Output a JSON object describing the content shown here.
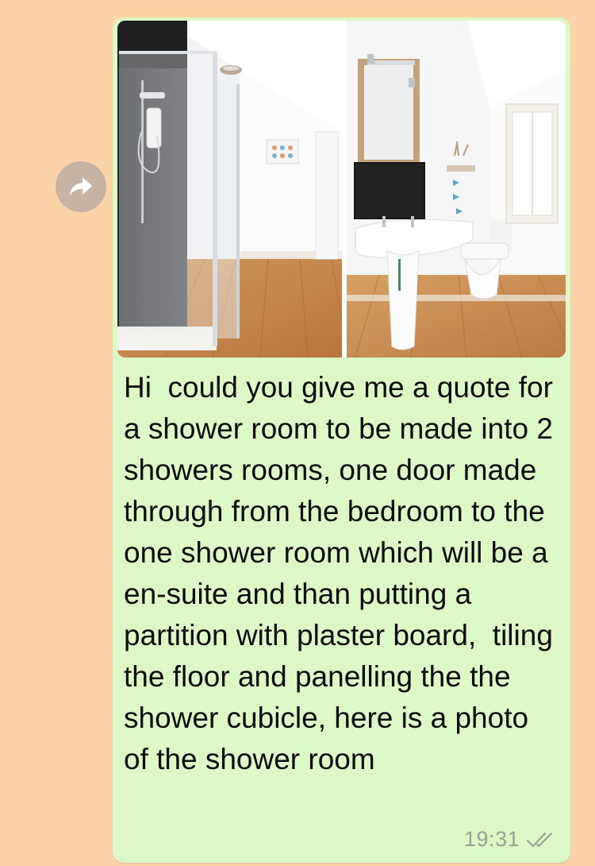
{
  "conversation": {
    "forward_icon": "forward-arrow-icon",
    "message": {
      "photo_alt": "Photo of the shower room: glass shower cubicle on the left, pedestal sink with mirror and toilet on the right, wooden floor",
      "text": "Hi  could you give me a quote for a shower room to be made into 2 showers rooms, one door made through from the bedroom to the one shower room which will be a en-suite and than putting a partition with plaster board,  tiling the floor and panelling the the shower cubicle, here is a photo of the shower room",
      "time": "19:31",
      "status_icon": "double-check-icon"
    }
  },
  "colors": {
    "background": "#fcd2a8",
    "bubble": "#dcf8c6",
    "forward_button": "#c7b3a4",
    "timestamp": "#9aa19a"
  }
}
